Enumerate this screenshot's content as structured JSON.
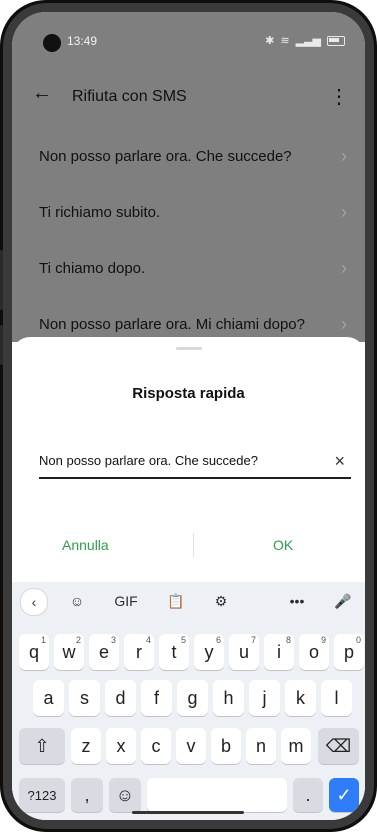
{
  "status": {
    "time": "13:49"
  },
  "appbar": {
    "title": "Rifiuta con SMS",
    "back_icon": "arrow-left-icon",
    "more_icon": "kebab-icon"
  },
  "list": {
    "items": [
      {
        "label": "Non posso parlare ora. Che succede?"
      },
      {
        "label": "Ti richiamo subito."
      },
      {
        "label": "Ti chiamo dopo."
      },
      {
        "label": "Non posso parlare ora. Mi chiami dopo?"
      }
    ]
  },
  "sheet": {
    "title": "Risposta rapida",
    "input_value": "Non posso parlare ora. Che succede?",
    "clear_icon": "close-icon",
    "cancel_label": "Annulla",
    "ok_label": "OK",
    "accent": "#2e9e4f"
  },
  "keyboard": {
    "toolbar": {
      "gif_label": "GIF",
      "more_label": "•••"
    },
    "row1": [
      {
        "key": "q",
        "hint": "1"
      },
      {
        "key": "w",
        "hint": "2"
      },
      {
        "key": "e",
        "hint": "3"
      },
      {
        "key": "r",
        "hint": "4"
      },
      {
        "key": "t",
        "hint": "5"
      },
      {
        "key": "y",
        "hint": "6"
      },
      {
        "key": "u",
        "hint": "7"
      },
      {
        "key": "i",
        "hint": "8"
      },
      {
        "key": "o",
        "hint": "9"
      },
      {
        "key": "p",
        "hint": "0"
      }
    ],
    "row2": [
      "a",
      "s",
      "d",
      "f",
      "g",
      "h",
      "j",
      "k",
      "l"
    ],
    "row3": [
      "z",
      "x",
      "c",
      "v",
      "b",
      "n",
      "m"
    ],
    "row4": {
      "symbols": "?123",
      "comma": ",",
      "period": "."
    },
    "enter_color": "#2f7df6"
  }
}
